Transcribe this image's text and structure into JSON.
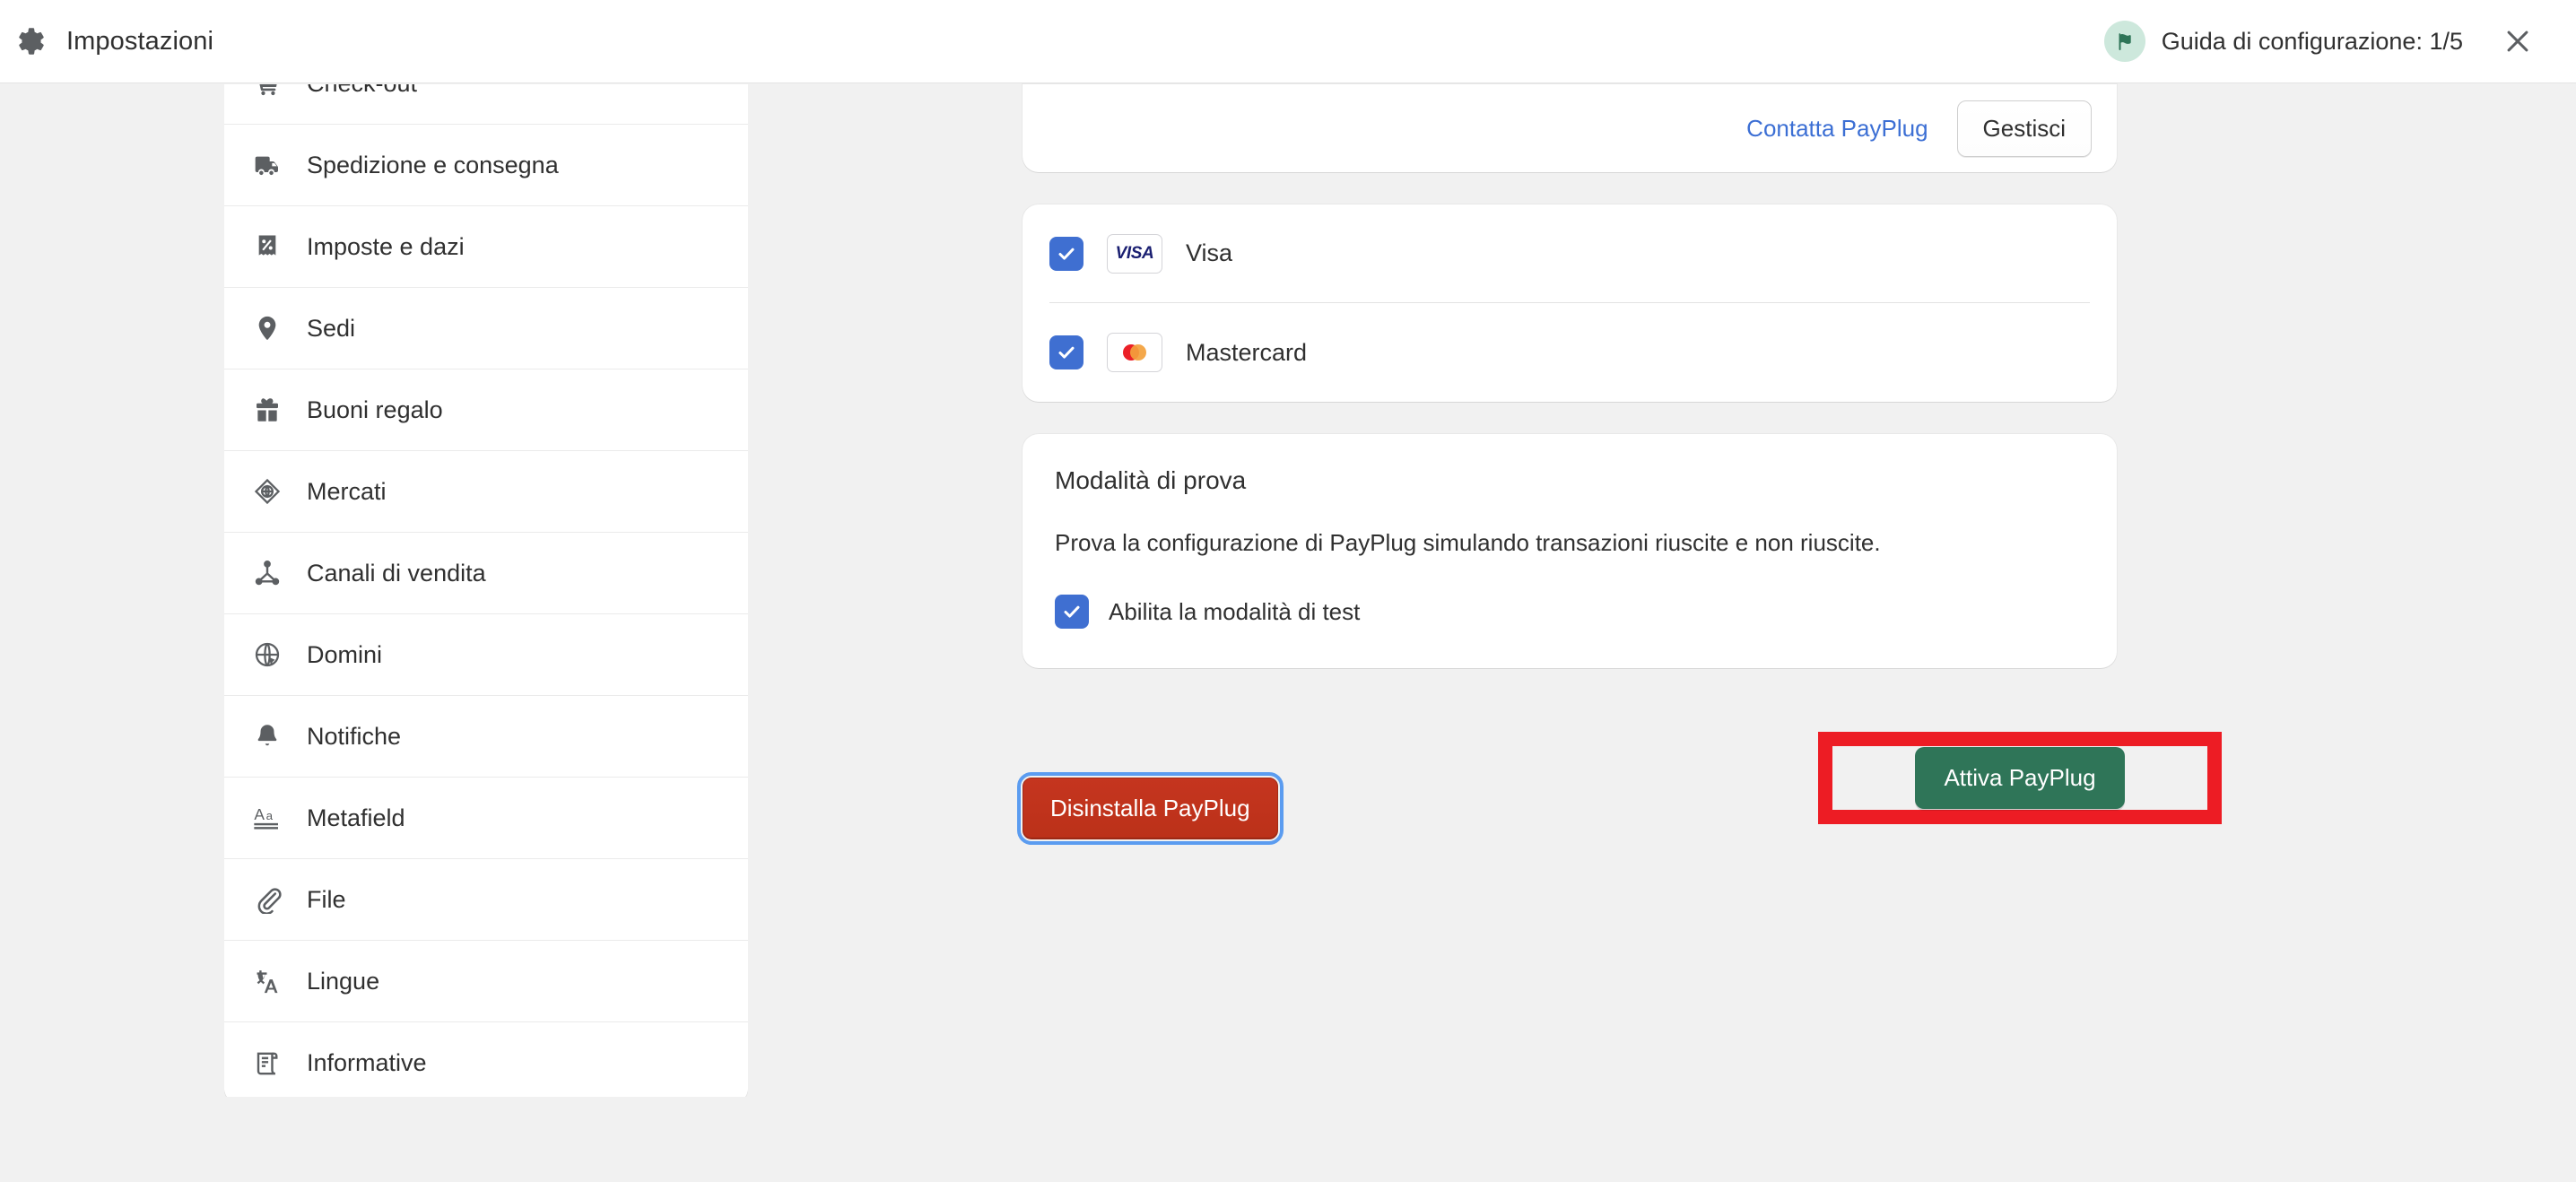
{
  "header": {
    "gear_icon": "gear-icon",
    "title": "Impostazioni",
    "setup_guide_label": "Guida di configurazione: 1/5",
    "flag_icon": "flag-icon",
    "close_icon": "close-icon"
  },
  "sidebar": {
    "items": [
      {
        "label": "Check-out",
        "icon": "cart-icon"
      },
      {
        "label": "Spedizione e consegna",
        "icon": "truck-icon"
      },
      {
        "label": "Imposte e dazi",
        "icon": "receipt-percent-icon"
      },
      {
        "label": "Sedi",
        "icon": "location-pin-icon"
      },
      {
        "label": "Buoni regalo",
        "icon": "gift-icon"
      },
      {
        "label": "Mercati",
        "icon": "markets-globe-icon"
      },
      {
        "label": "Canali di vendita",
        "icon": "network-nodes-icon"
      },
      {
        "label": "Domini",
        "icon": "globe-icon"
      },
      {
        "label": "Notifiche",
        "icon": "bell-icon"
      },
      {
        "label": "Metafield",
        "icon": "text-aa-icon"
      },
      {
        "label": "File",
        "icon": "paperclip-icon"
      },
      {
        "label": "Lingue",
        "icon": "translate-icon"
      },
      {
        "label": "Informative",
        "icon": "policy-scroll-icon"
      }
    ]
  },
  "main": {
    "top_card": {
      "contact_link": "Contatta PayPlug",
      "manage_button": "Gestisci"
    },
    "payment_methods": [
      {
        "name": "Visa",
        "checked": true,
        "logo": "visa-logo",
        "logo_text": "VISA"
      },
      {
        "name": "Mastercard",
        "checked": true,
        "logo": "mastercard-logo"
      }
    ],
    "test_mode": {
      "heading": "Modalità di prova",
      "description": "Prova la configurazione di PayPlug simulando transazioni riuscite e non riuscite.",
      "checkbox_label": "Abilita la modalità di test",
      "checked": true
    },
    "actions": {
      "uninstall_button": "Disinstalla PayPlug",
      "activate_button": "Attiva PayPlug"
    }
  },
  "colors": {
    "accent_blue": "#3f6fd1",
    "link_blue": "#3c6fd4",
    "danger_red": "#c5351f",
    "primary_green": "#2f7558",
    "annotation_red": "#ed1c24",
    "badge_green_bg": "#cde8dc",
    "page_bg": "#f1f1f1"
  }
}
